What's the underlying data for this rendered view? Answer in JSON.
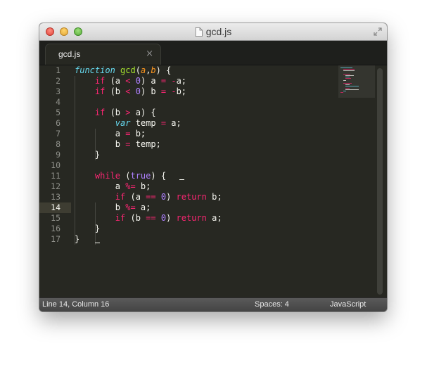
{
  "window": {
    "title": "gcd.js"
  },
  "tab": {
    "label": "gcd.js",
    "close_glyph": "×",
    "close_icon": "close-icon"
  },
  "editor": {
    "active_line": 14,
    "line_numbers": [
      "1",
      "2",
      "3",
      "4",
      "5",
      "6",
      "7",
      "8",
      "9",
      "10",
      "11",
      "12",
      "13",
      "14",
      "15",
      "16",
      "17"
    ],
    "code_lines": [
      "function gcd(a,b) {",
      "    if (a < 0) a = -a;",
      "    if (b < 0) b = -b;",
      "",
      "    if (b > a) {",
      "        var temp = a;",
      "        a = b;",
      "        b = temp;",
      "    }",
      "",
      "    while (true) {",
      "        a %= b;",
      "        if (a == 0) return b;",
      "        b %= a;",
      "        if (b == 0) return a;",
      "    }",
      "}"
    ]
  },
  "status": {
    "position": "Line 14, Column 16",
    "indentation": "Spaces: 4",
    "syntax": "JavaScript"
  },
  "colors": {
    "background": "#272822",
    "keyword": "#f92672",
    "storage": "#66d9ef",
    "function_name": "#a6e22e",
    "parameter": "#fd971f",
    "number": "#ae81ff",
    "text": "#f8f8f2"
  }
}
